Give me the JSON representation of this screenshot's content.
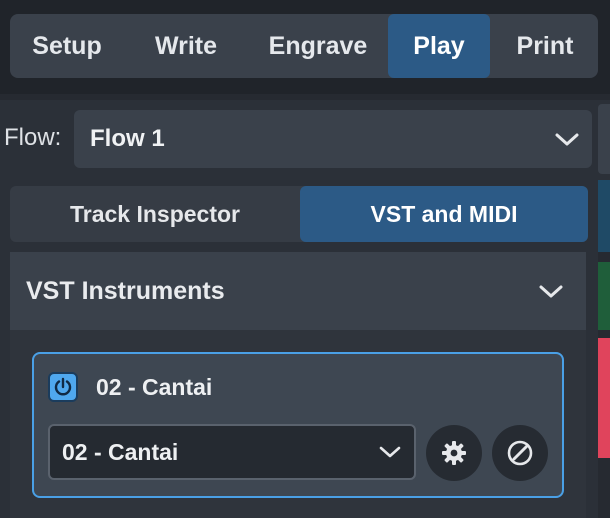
{
  "mode_tabs": [
    {
      "label": "Setup",
      "active": false
    },
    {
      "label": "Write",
      "active": false
    },
    {
      "label": "Engrave",
      "active": false
    },
    {
      "label": "Play",
      "active": true
    },
    {
      "label": "Print",
      "active": false
    }
  ],
  "flow": {
    "label": "Flow:",
    "selected": "Flow 1"
  },
  "panel_tabs": [
    {
      "label": "Track Inspector",
      "active": false
    },
    {
      "label": "VST and MIDI",
      "active": true
    }
  ],
  "vst_section": {
    "title": "VST Instruments",
    "instrument": {
      "name": "02 - Cantai",
      "selected": "02 - Cantai",
      "powered": true
    }
  },
  "icons": {
    "power": "power-icon",
    "settings": "gear-icon",
    "edit": "edit-icon",
    "dropdown": "chevron-down-icon"
  },
  "colors": {
    "accent": "#2c5a86",
    "card_border": "#4aa0e6",
    "strip_blue": "#1f4a66",
    "strip_green": "#1f5e3a",
    "strip_red": "#e0445c"
  }
}
